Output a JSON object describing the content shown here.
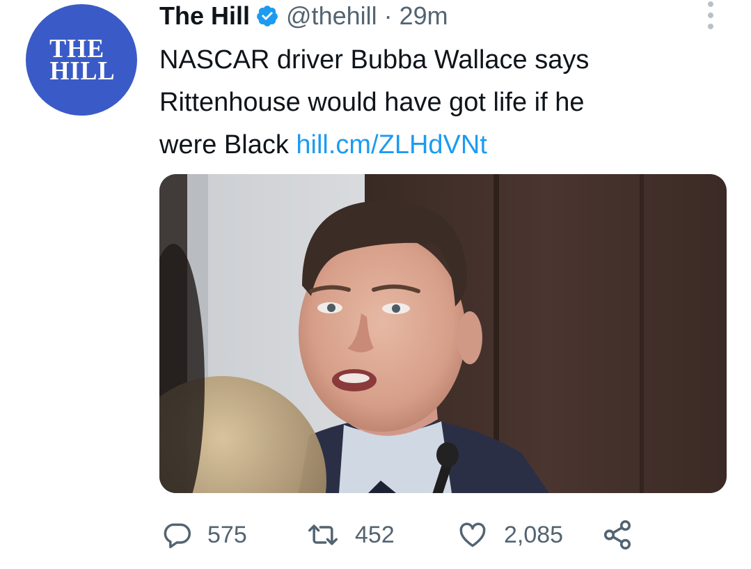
{
  "tweet": {
    "avatar": {
      "line1": "THE",
      "line2": "HILL",
      "color": "#3a5bc7"
    },
    "author": {
      "name": "The Hill",
      "handle": "@thehill",
      "separator": "·",
      "time": "29m",
      "verified": true
    },
    "text": {
      "line1": "NASCAR driver Bubba Wallace says",
      "line2": "Rittenhouse would have got life if he",
      "line3": "were Black ",
      "link": "hill.cm/ZLHdVNt"
    },
    "media": {
      "kind": "photo"
    },
    "stats": {
      "replies": "575",
      "retweets": "452",
      "likes": "2,085"
    },
    "icons": {
      "verified": "verified-badge-icon",
      "more": "more-options-icon",
      "reply": "reply-bubble-icon",
      "retweet": "retweet-arrows-icon",
      "like": "heart-icon",
      "share": "share-icon"
    },
    "colors": {
      "text": "#0f1419",
      "muted": "#536471",
      "link": "#1d9bf0"
    }
  }
}
